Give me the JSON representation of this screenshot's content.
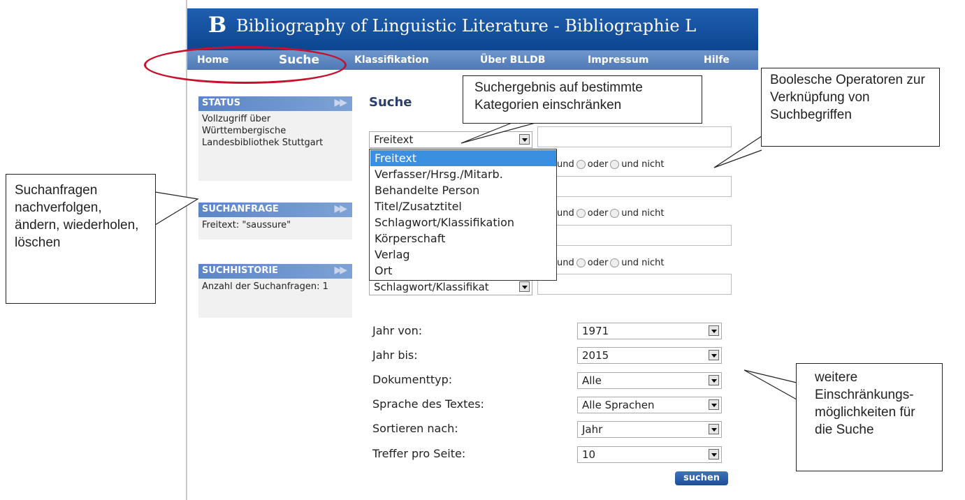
{
  "header": {
    "logo": "B",
    "title": "Bibliography of Linguistic Literature - Bibliographie L"
  },
  "nav": [
    {
      "label": "Home"
    },
    {
      "label": "Suche"
    },
    {
      "label": "Klassifikation"
    },
    {
      "label": "Über BLLDB"
    },
    {
      "label": "Impressum"
    },
    {
      "label": "Hilfe"
    }
  ],
  "sidebar": {
    "status": {
      "heading": "STATUS",
      "text": "Vollzugriff über Württembergische Landesbibliothek Stuttgart"
    },
    "suchanfrage": {
      "heading": "SUCHANFRAGE",
      "text": "Freitext: \"saussure\""
    },
    "suchhistorie": {
      "heading": "SUCHHISTORIE",
      "text": "Anzahl der Suchanfragen: 1"
    },
    "arrow_icon": "double-chevron-right"
  },
  "main": {
    "title": "Suche",
    "field1_selected": "Freitext",
    "field4_selected": "Schlagwort/Klassifikat",
    "dropdown_options": [
      "Freitext",
      "Verfasser/Hrsg./Mitarb.",
      "Behandelte Person",
      "Titel/Zusatztitel",
      "Schlagwort/Klassifikation",
      "Körperschaft",
      "Verlag",
      "Ort"
    ],
    "boolean": {
      "und": "und",
      "oder": "oder",
      "und_nicht": "und nicht"
    },
    "filters": [
      {
        "label": "Jahr von:",
        "value": "1971"
      },
      {
        "label": "Jahr bis:",
        "value": "2015"
      },
      {
        "label": "Dokumenttyp:",
        "value": "Alle"
      },
      {
        "label": "Sprache des Textes:",
        "value": "Alle Sprachen"
      },
      {
        "label": "Sortieren nach:",
        "value": "Jahr"
      },
      {
        "label": "Treffer pro Seite:",
        "value": "10"
      }
    ],
    "search_button": "suchen"
  },
  "callouts": {
    "categories": "Suchergebnis auf bestimmte Kategorien einschränken",
    "boolean": "Boolesche Operatoren zur Verknüpfung von Suchbegriffen",
    "history": "Suchanfragen nachverfolgen, ändern, wiederholen, löschen",
    "filters": "weitere Einschränkungs-möglichkeiten für die Suche"
  },
  "colors": {
    "header": "#0c4591",
    "nav": "#5a82be",
    "highlight": "#3a8fe0",
    "annotation_ellipse": "#c8102e"
  }
}
